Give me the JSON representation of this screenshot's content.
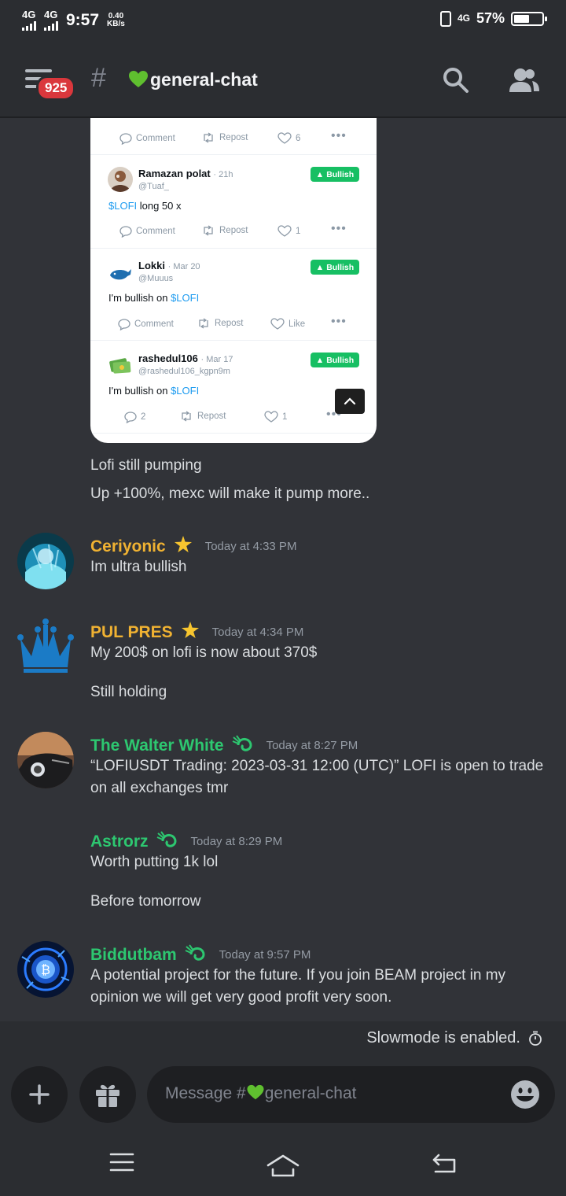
{
  "status_bar": {
    "net1": "4G",
    "net2": "4G",
    "time": "9:57",
    "speed_value": "0.40",
    "speed_unit": "KB/s",
    "net3": "4G",
    "battery_percent": "57%",
    "battery_level": 0.57
  },
  "header": {
    "badge": "925",
    "hash": "#",
    "channel_name": "general-chat",
    "icons": [
      "menu-icon",
      "search-icon",
      "members-icon"
    ]
  },
  "embed": {
    "top_actions": {
      "comment": "Comment",
      "repost": "Repost",
      "like": "6"
    },
    "tweets": [
      {
        "name": "Ramazan polat",
        "time": "· 21h",
        "handle": "@Tuaf_",
        "text_pre": "",
        "cashtag": "$LOFI",
        "text_post": " long 50 x",
        "tag": "Bullish",
        "comment": "Comment",
        "repost": "Repost",
        "like": "1"
      },
      {
        "name": "Lokki",
        "time": "· Mar 20",
        "handle": "@Muuus",
        "text_pre": "I'm bullish on ",
        "cashtag": "$LOFI",
        "text_post": "",
        "tag": "Bullish",
        "comment": "Comment",
        "repost": "Repost",
        "like": "Like"
      },
      {
        "name": "rashedul106",
        "time": "· Mar 17",
        "handle": "@rashedul106_kgpn9m",
        "text_pre": "I'm bullish on ",
        "cashtag": "$LOFI",
        "text_post": "",
        "tag": "Bullish",
        "comment": "2",
        "repost": "Repost",
        "like": "1"
      }
    ]
  },
  "messages": {
    "cont1": "Lofi still pumping",
    "cont2": "Up +100%, mexc will make it pump more..",
    "ceriyonic": {
      "author": "Ceriyonic",
      "time": "Today at 4:33 PM",
      "text": "Im ultra bullish"
    },
    "pulpres": {
      "author": "PUL PRES",
      "time": "Today at 4:34 PM",
      "text": "My 200$ on lofi is now about 370$",
      "text2": "Still holding"
    },
    "walter": {
      "author": "The Walter White",
      "time": "Today at 8:27 PM",
      "line1": "“LOFIUSDT Trading: 2023-03-31 12:00 (UTC)” LOFI is open to trade",
      "line2": "on all exchanges tmr"
    },
    "astrorz": {
      "author": "Astrorz",
      "time": "Today at 8:29 PM",
      "text": "Worth putting 1k lol",
      "text2": "Before tomorrow"
    },
    "biddutbam": {
      "author": "Biddutbam",
      "time": "Today at 9:57 PM",
      "line1": "A potential project for the future. If you join BEAM project in my",
      "line2": "opinion we will get very good profit very soon."
    }
  },
  "slowmode": "Slowmode is enabled.",
  "composer": {
    "placeholder_prefix": "Message #",
    "placeholder_channel": "general-chat"
  },
  "colors": {
    "background": "#313338",
    "header": "#2b2d31",
    "gold_role": "#f0b232",
    "green_role": "#2dc770",
    "badge": "#da373c",
    "bullish": "#17bf63"
  }
}
